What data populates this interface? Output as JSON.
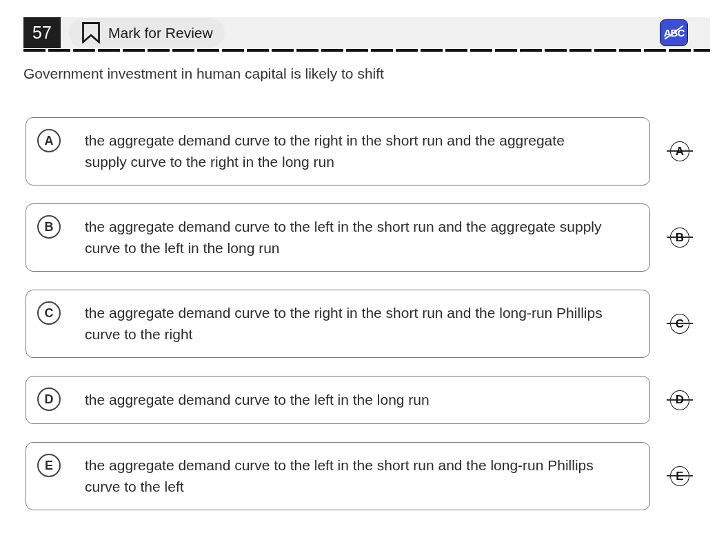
{
  "header": {
    "question_number": "57",
    "mark_for_review": {
      "label": "Mark for Review",
      "checked": false
    },
    "eliminator_tool": {
      "label": "ABC",
      "on": true
    }
  },
  "question": "Government investment in human capital is likely to shift",
  "options": [
    {
      "letter": "A",
      "text": "the aggregate demand curve to the right in the short run and the aggregate\nsupply curve to the right in the long run",
      "selected": false,
      "eliminated": false,
      "eliminate_label": "A"
    },
    {
      "letter": "B",
      "text": "the aggregate demand curve to the left in the short run and the aggregate supply\ncurve to the left in the long run",
      "selected": false,
      "eliminated": false,
      "eliminate_label": "B"
    },
    {
      "letter": "C",
      "text": "the aggregate demand curve to the right in the short run and the long-run Phillips\ncurve to the right",
      "selected": false,
      "eliminated": false,
      "eliminate_label": "C"
    },
    {
      "letter": "D",
      "text": "the aggregate demand curve to the left in the long run",
      "selected": false,
      "eliminated": false,
      "eliminate_label": "D"
    },
    {
      "letter": "E",
      "text": "the aggregate demand curve to the left in the short run and the long-run Phillips\ncurve to the left",
      "selected": false,
      "eliminated": false,
      "eliminate_label": "E"
    }
  ]
}
